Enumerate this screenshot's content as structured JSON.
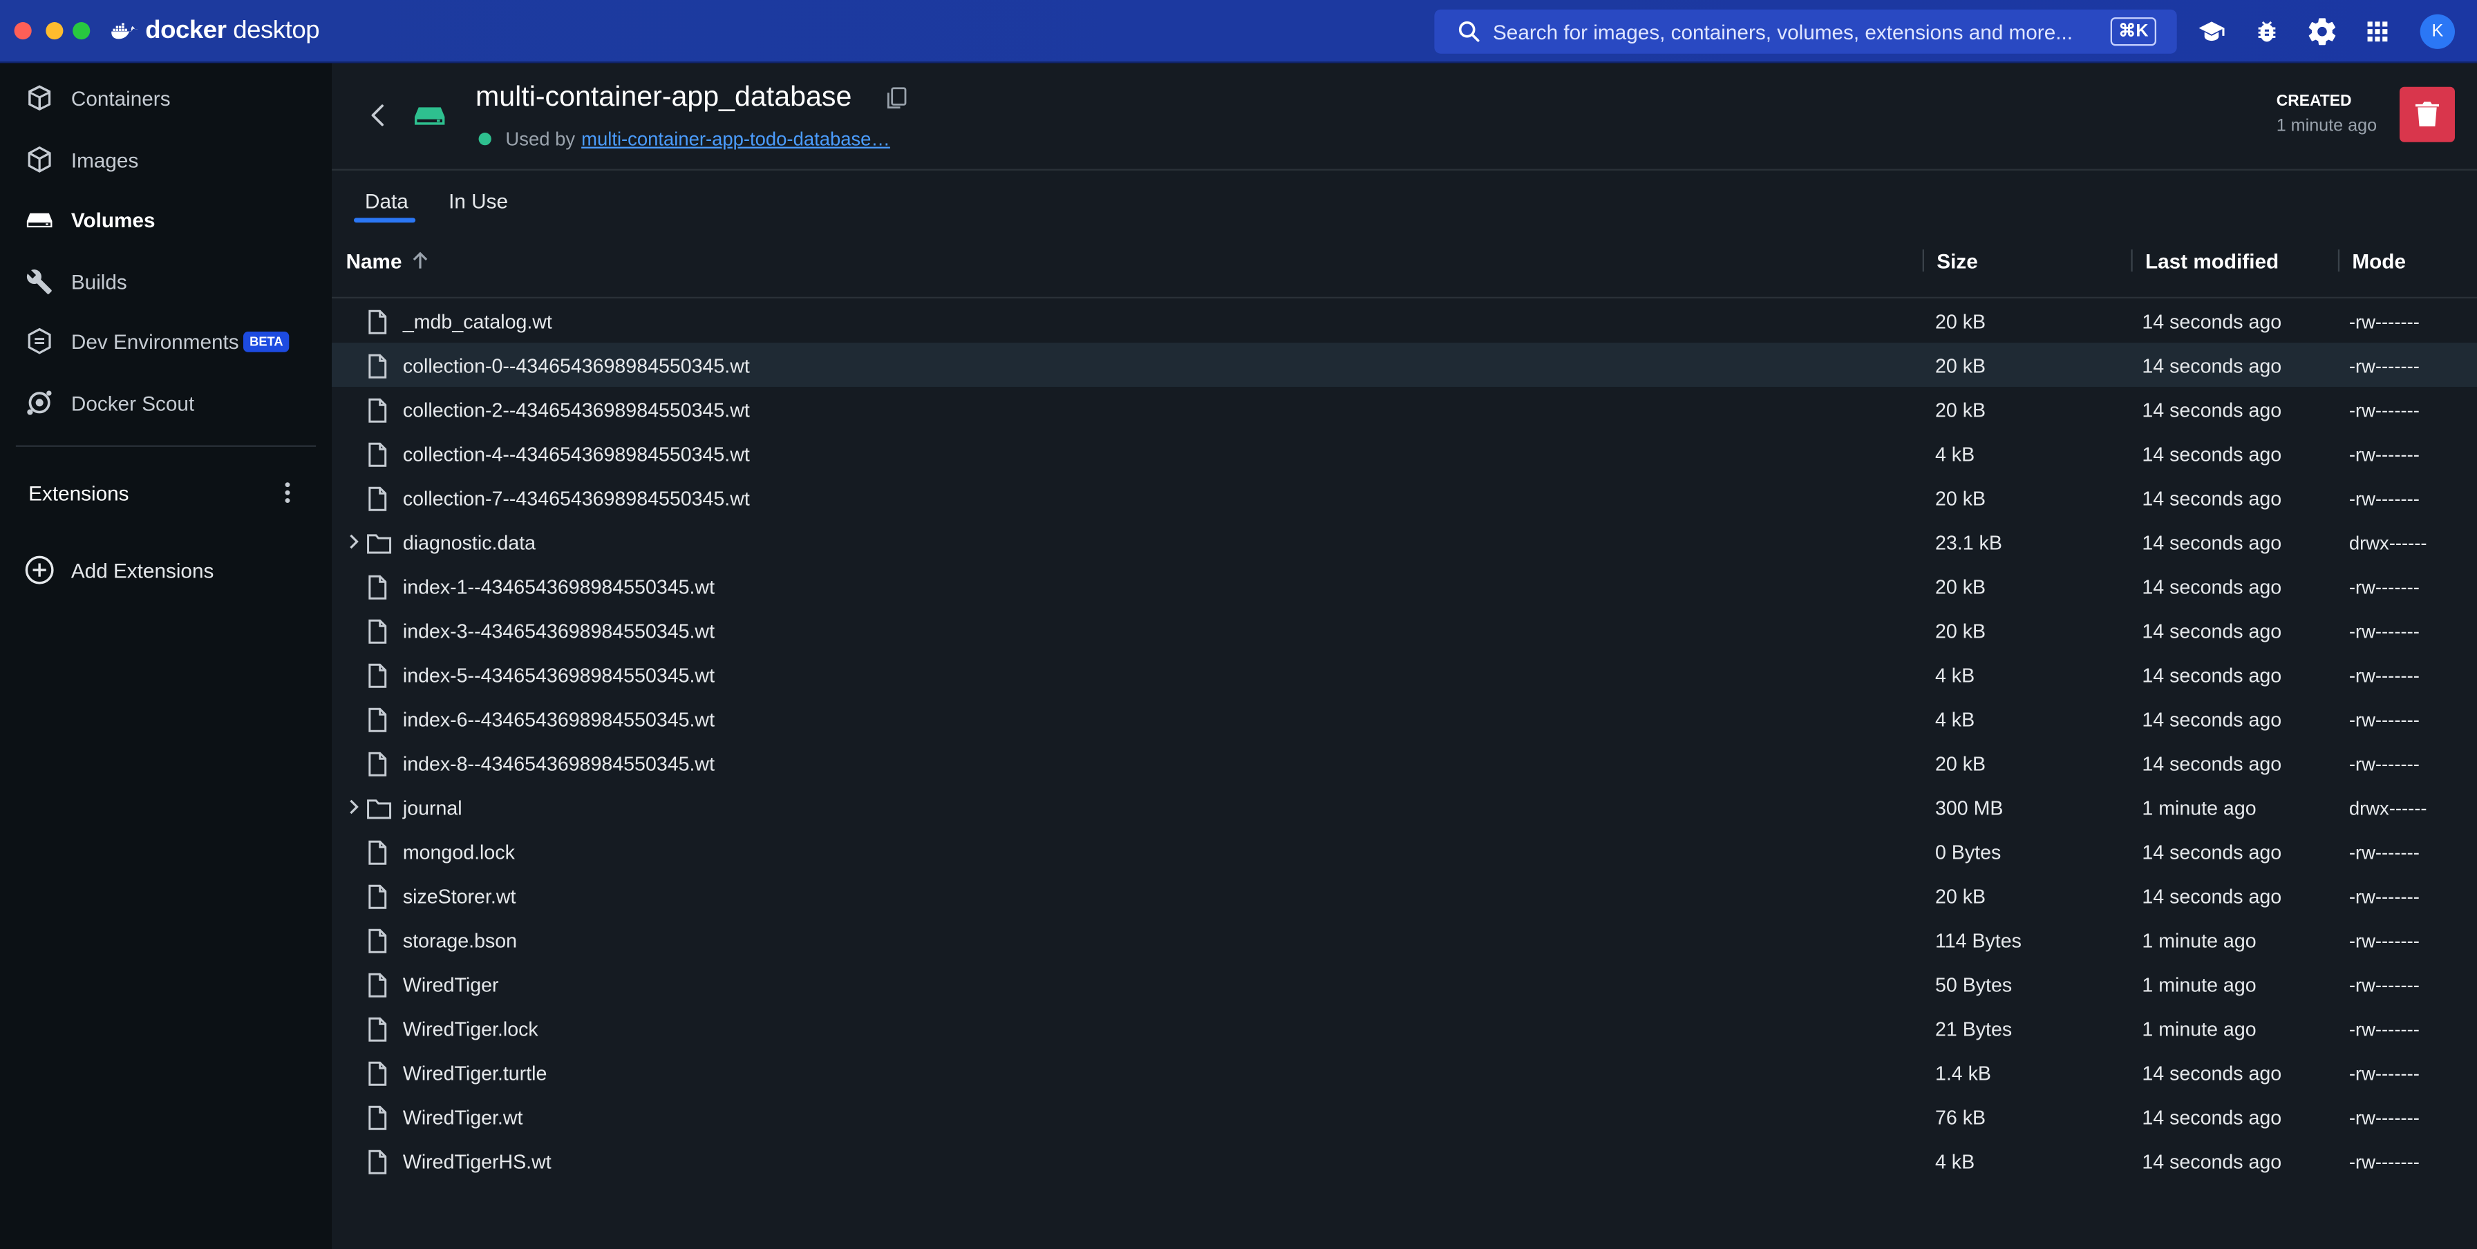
{
  "app": {
    "brand_prefix": "docker",
    "brand_suffix": " desktop"
  },
  "search": {
    "placeholder": "Search for images, containers, volumes, extensions and more...",
    "shortcut": "⌘K"
  },
  "user": {
    "avatar_initial": "K"
  },
  "sidebar": {
    "items": [
      {
        "label": "Containers",
        "icon": "container-icon",
        "active": false
      },
      {
        "label": "Images",
        "icon": "image-icon",
        "active": false
      },
      {
        "label": "Volumes",
        "icon": "volume-icon",
        "active": true
      },
      {
        "label": "Builds",
        "icon": "wrench-icon",
        "active": false
      },
      {
        "label": "Dev Environments",
        "icon": "dev-env-icon",
        "active": false,
        "badge": "BETA"
      },
      {
        "label": "Docker Scout",
        "icon": "scout-icon",
        "active": false
      }
    ],
    "extensions_label": "Extensions",
    "add_extensions_label": "Add Extensions"
  },
  "volume": {
    "title": "multi-container-app_database",
    "used_by_label": "Used by",
    "used_by_link": "multi-container-app-todo-database…",
    "created_label": "CREATED",
    "created_value": "1 minute ago"
  },
  "tabs": [
    {
      "label": "Data",
      "active": true
    },
    {
      "label": "In Use",
      "active": false
    }
  ],
  "table": {
    "columns": {
      "name": "Name",
      "size": "Size",
      "modified": "Last modified",
      "mode": "Mode"
    },
    "rows": [
      {
        "name": "_mdb_catalog.wt",
        "type": "file",
        "size": "20 kB",
        "modified": "14 seconds ago",
        "mode": "-rw-------"
      },
      {
        "name": "collection-0--4346543698984550345.wt",
        "type": "file",
        "size": "20 kB",
        "modified": "14 seconds ago",
        "mode": "-rw-------"
      },
      {
        "name": "collection-2--4346543698984550345.wt",
        "type": "file",
        "size": "20 kB",
        "modified": "14 seconds ago",
        "mode": "-rw-------"
      },
      {
        "name": "collection-4--4346543698984550345.wt",
        "type": "file",
        "size": "4 kB",
        "modified": "14 seconds ago",
        "mode": "-rw-------"
      },
      {
        "name": "collection-7--4346543698984550345.wt",
        "type": "file",
        "size": "20 kB",
        "modified": "14 seconds ago",
        "mode": "-rw-------"
      },
      {
        "name": "diagnostic.data",
        "type": "folder",
        "size": "23.1 kB",
        "modified": "14 seconds ago",
        "mode": "drwx------"
      },
      {
        "name": "index-1--4346543698984550345.wt",
        "type": "file",
        "size": "20 kB",
        "modified": "14 seconds ago",
        "mode": "-rw-------"
      },
      {
        "name": "index-3--4346543698984550345.wt",
        "type": "file",
        "size": "20 kB",
        "modified": "14 seconds ago",
        "mode": "-rw-------"
      },
      {
        "name": "index-5--4346543698984550345.wt",
        "type": "file",
        "size": "4 kB",
        "modified": "14 seconds ago",
        "mode": "-rw-------"
      },
      {
        "name": "index-6--4346543698984550345.wt",
        "type": "file",
        "size": "4 kB",
        "modified": "14 seconds ago",
        "mode": "-rw-------"
      },
      {
        "name": "index-8--4346543698984550345.wt",
        "type": "file",
        "size": "20 kB",
        "modified": "14 seconds ago",
        "mode": "-rw-------"
      },
      {
        "name": "journal",
        "type": "folder",
        "size": "300 MB",
        "modified": "1 minute ago",
        "mode": "drwx------"
      },
      {
        "name": "mongod.lock",
        "type": "file",
        "size": "0 Bytes",
        "modified": "14 seconds ago",
        "mode": "-rw-------"
      },
      {
        "name": "sizeStorer.wt",
        "type": "file",
        "size": "20 kB",
        "modified": "14 seconds ago",
        "mode": "-rw-------"
      },
      {
        "name": "storage.bson",
        "type": "file",
        "size": "114 Bytes",
        "modified": "1 minute ago",
        "mode": "-rw-------"
      },
      {
        "name": "WiredTiger",
        "type": "file",
        "size": "50 Bytes",
        "modified": "1 minute ago",
        "mode": "-rw-------"
      },
      {
        "name": "WiredTiger.lock",
        "type": "file",
        "size": "21 Bytes",
        "modified": "1 minute ago",
        "mode": "-rw-------"
      },
      {
        "name": "WiredTiger.turtle",
        "type": "file",
        "size": "1.4 kB",
        "modified": "14 seconds ago",
        "mode": "-rw-------"
      },
      {
        "name": "WiredTiger.wt",
        "type": "file",
        "size": "76 kB",
        "modified": "14 seconds ago",
        "mode": "-rw-------"
      },
      {
        "name": "WiredTigerHS.wt",
        "type": "file",
        "size": "4 kB",
        "modified": "14 seconds ago",
        "mode": "-rw-------"
      }
    ]
  },
  "colors": {
    "titlebar": "#1d3a9e",
    "accent": "#2b77f5",
    "danger": "#d9364c",
    "status_green": "#2ec08f",
    "background": "#151b22",
    "sidebar": "#0c1115"
  }
}
